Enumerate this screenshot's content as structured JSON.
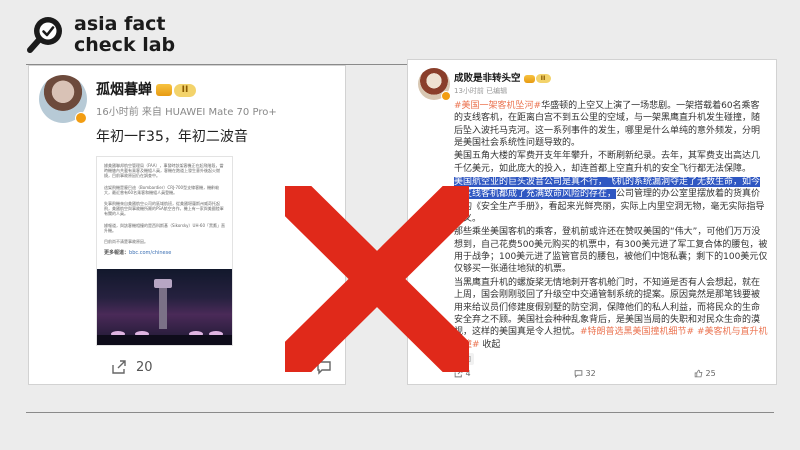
{
  "brand": {
    "line1": "asia fact",
    "line2": "check lab",
    "color": "#1b1b1b"
  },
  "left_post": {
    "username": "孤烟暮蝉",
    "level": "II",
    "meta": "16小时前  来自 HUAWEI Mate 70 Pro+",
    "text": "年初一F35，年初二波音",
    "screenshot": {
      "paragraphs": [
        "據美國聯邦航空管理局（FAA），事發時該架客機正在起飛階段，當時機艙內共載有乘客及機組人員，客機在跑道上發生意外後起火燃燒，目前事故原因仍在調查中。",
        "這架飛機是龐巴迪（Bombardier）CRJ-700型支線客機，機齡較大，最近曾有60名乘客和機組人員登機。",
        "失事飛機來自美國航空公司的區域航班，從美國堪薩斯州威奇托起飛，美國航空與事故機所屬的PSA航空合作，機上有一家與美國陸軍有關的人員。",
        "據報道，與該客機相撞的是西科斯基（Sikorsky）UH-60「黑鷹」直升機。",
        "目前尚不清楚事故原因。"
      ],
      "link_label": "更多報道：",
      "link_url": "bbc.com/chinese"
    },
    "actions": {
      "share_count": "20",
      "comment_count": ""
    }
  },
  "right_post": {
    "username": "成败是非转头空",
    "level": "II",
    "meta": "13小时前  已编辑",
    "edited_label": "已编辑",
    "actions": {
      "share": "4",
      "comment": "32",
      "like": "25"
    },
    "edit_label": "添加",
    "highlight_color": "#2f57c2",
    "tag_color": "#eb7350"
  },
  "overlay": {
    "x_color": "#e0291a"
  }
}
